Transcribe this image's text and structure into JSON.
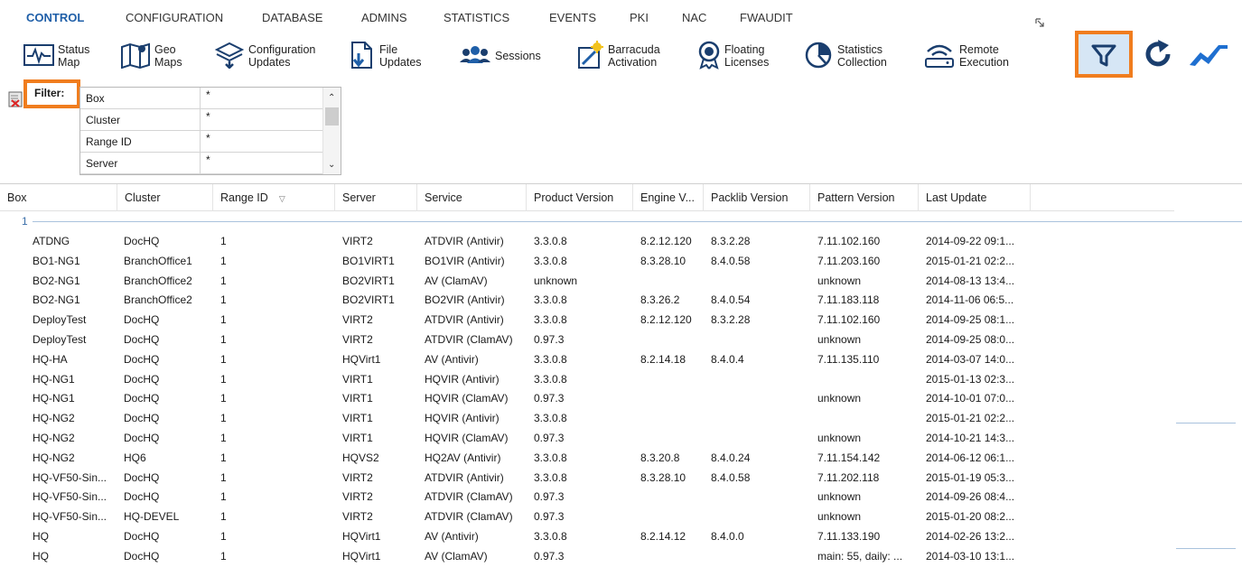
{
  "menu": {
    "items": [
      "CONTROL",
      "CONFIGURATION",
      "DATABASE",
      "ADMINS",
      "STATISTICS",
      "EVENTS",
      "PKI",
      "NAC",
      "FWAUDIT"
    ],
    "active": "CONTROL"
  },
  "toolbar": {
    "buttons": [
      {
        "label": "Status\nMap",
        "icon": "status-map-icon"
      },
      {
        "label": "Geo\nMaps",
        "icon": "geo-maps-icon"
      },
      {
        "label": "Configuration\nUpdates",
        "icon": "configuration-updates-icon"
      },
      {
        "label": "File\nUpdates",
        "icon": "file-updates-icon"
      },
      {
        "label": "Sessions",
        "icon": "sessions-icon"
      },
      {
        "label": "Barracuda\nActivation",
        "icon": "barracuda-activation-icon"
      },
      {
        "label": "Floating\nLicenses",
        "icon": "floating-licenses-icon"
      },
      {
        "label": "Statistics\nCollection",
        "icon": "statistics-collection-icon"
      },
      {
        "label": "Remote\nExecution",
        "icon": "remote-execution-icon"
      }
    ],
    "right_icons": [
      "filter-icon",
      "refresh-icon",
      "trend-icon"
    ]
  },
  "filter": {
    "label": "Filter:",
    "rows": [
      {
        "name": "Box",
        "value": "*"
      },
      {
        "name": "Cluster",
        "value": "*"
      },
      {
        "name": "Range ID",
        "value": "*"
      },
      {
        "name": "Server",
        "value": "*"
      }
    ]
  },
  "table": {
    "columns": [
      "Box",
      "Cluster",
      "Range ID",
      "Server",
      "Service",
      "Product Version",
      "Engine V...",
      "Packlib Version",
      "Pattern Version",
      "Last Update"
    ],
    "group_label": "1",
    "rows": [
      [
        "ATDNG",
        "DocHQ",
        "1",
        "VIRT2",
        "ATDVIR (Antivir)",
        "3.3.0.8",
        "8.2.12.120",
        "8.3.2.28",
        "7.11.102.160",
        "2014-09-22 09:1..."
      ],
      [
        "BO1-NG1",
        "BranchOffice1",
        "1",
        "BO1VIRT1",
        "BO1VIR (Antivir)",
        "3.3.0.8",
        "8.3.28.10",
        "8.4.0.58",
        "7.11.203.160",
        "2015-01-21 02:2..."
      ],
      [
        "BO2-NG1",
        "BranchOffice2",
        "1",
        "BO2VIRT1",
        "AV (ClamAV)",
        "unknown",
        "",
        "",
        "unknown",
        "2014-08-13 13:4..."
      ],
      [
        "BO2-NG1",
        "BranchOffice2",
        "1",
        "BO2VIRT1",
        "BO2VIR (Antivir)",
        "3.3.0.8",
        "8.3.26.2",
        "8.4.0.54",
        "7.11.183.118",
        "2014-11-06 06:5..."
      ],
      [
        "DeployTest",
        "DocHQ",
        "1",
        "VIRT2",
        "ATDVIR (Antivir)",
        "3.3.0.8",
        "8.2.12.120",
        "8.3.2.28",
        "7.11.102.160",
        "2014-09-25 08:1..."
      ],
      [
        "DeployTest",
        "DocHQ",
        "1",
        "VIRT2",
        "ATDVIR (ClamAV)",
        "0.97.3",
        "",
        "",
        "unknown",
        "2014-09-25 08:0..."
      ],
      [
        "HQ-HA",
        "DocHQ",
        "1",
        "HQVirt1",
        "AV (Antivir)",
        "3.3.0.8",
        "8.2.14.18",
        "8.4.0.4",
        "7.11.135.110",
        "2014-03-07 14:0..."
      ],
      [
        "HQ-NG1",
        "DocHQ",
        "1",
        "VIRT1",
        "HQVIR (Antivir)",
        "3.3.0.8",
        "",
        "",
        "",
        "2015-01-13 02:3..."
      ],
      [
        "HQ-NG1",
        "DocHQ",
        "1",
        "VIRT1",
        "HQVIR (ClamAV)",
        "0.97.3",
        "",
        "",
        "unknown",
        "2014-10-01 07:0..."
      ],
      [
        "HQ-NG2",
        "DocHQ",
        "1",
        "VIRT1",
        "HQVIR (Antivir)",
        "3.3.0.8",
        "",
        "",
        "",
        "2015-01-21 02:2..."
      ],
      [
        "HQ-NG2",
        "DocHQ",
        "1",
        "VIRT1",
        "HQVIR (ClamAV)",
        "0.97.3",
        "",
        "",
        "unknown",
        "2014-10-21 14:3..."
      ],
      [
        "HQ-NG2",
        "HQ6",
        "1",
        "HQVS2",
        "HQ2AV (Antivir)",
        "3.3.0.8",
        "8.3.20.8",
        "8.4.0.24",
        "7.11.154.142",
        "2014-06-12 06:1..."
      ],
      [
        "HQ-VF50-Sin...",
        "DocHQ",
        "1",
        "VIRT2",
        "ATDVIR (Antivir)",
        "3.3.0.8",
        "8.3.28.10",
        "8.4.0.58",
        "7.11.202.118",
        "2015-01-19 05:3..."
      ],
      [
        "HQ-VF50-Sin...",
        "DocHQ",
        "1",
        "VIRT2",
        "ATDVIR (ClamAV)",
        "0.97.3",
        "",
        "",
        "unknown",
        "2014-09-26 08:4..."
      ],
      [
        "HQ-VF50-Sin...",
        "HQ-DEVEL",
        "1",
        "VIRT2",
        "ATDVIR (ClamAV)",
        "0.97.3",
        "",
        "",
        "unknown",
        "2015-01-20 08:2..."
      ],
      [
        "HQ",
        "DocHQ",
        "1",
        "HQVirt1",
        "AV (Antivir)",
        "3.3.0.8",
        "8.2.14.12",
        "8.4.0.0",
        "7.11.133.190",
        "2014-02-26 13:2..."
      ],
      [
        "HQ",
        "DocHQ",
        "1",
        "HQVirt1",
        "AV (ClamAV)",
        "0.97.3",
        "",
        "",
        "main: 55, daily: ...",
        "2014-03-10 13:1..."
      ]
    ]
  },
  "colors": {
    "accent": "#1f5fa8",
    "highlight": "#f07d1e",
    "selected_bg": "#d6e6f5",
    "trend": "#1f6fd0"
  }
}
